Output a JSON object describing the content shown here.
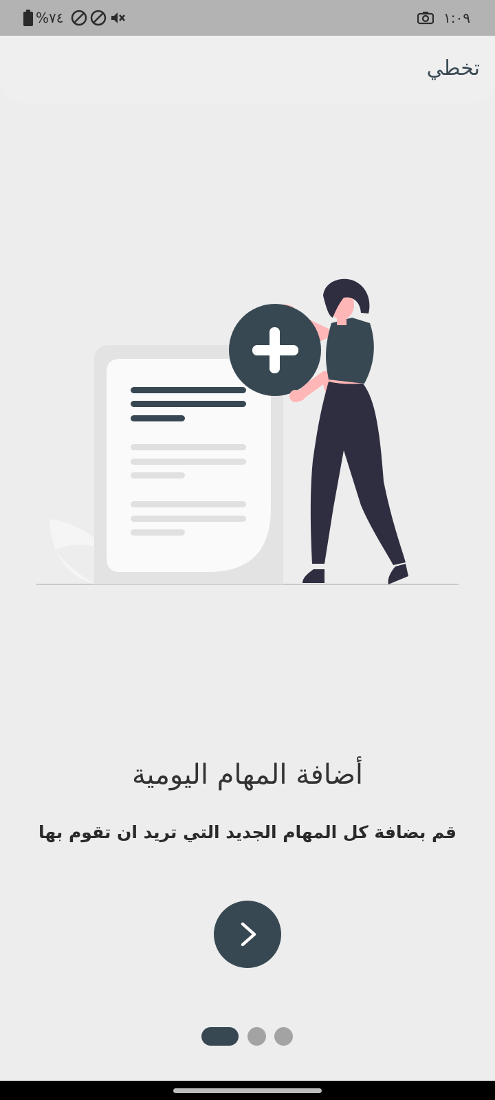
{
  "status_bar": {
    "battery_text": "%٧٤",
    "time": "١:٠٩",
    "icons": [
      "battery-icon",
      "dnd-icon",
      "dnd-icon",
      "mute-icon",
      "camera-icon"
    ]
  },
  "top_bar": {
    "skip_label": "تخطي"
  },
  "onboarding": {
    "title": "أضافة المهام اليومية",
    "description": "قم بضافة كل المهام الجديد التي تريد ان تقوم بها",
    "next_icon": "chevron-right-icon",
    "page_indicator": {
      "total": 3,
      "current": 1
    }
  },
  "colors": {
    "accent": "#374852",
    "background": "#ededed",
    "dot_inactive": "#a3a3a3",
    "figure_dark": "#2f2e41",
    "skin": "#ffb6b6"
  }
}
